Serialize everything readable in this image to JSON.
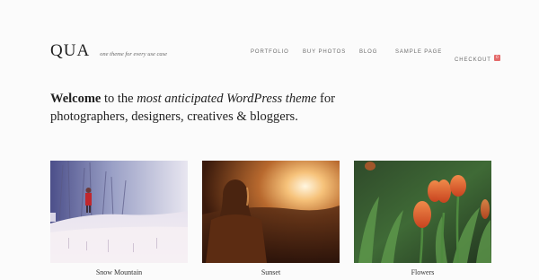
{
  "site": {
    "logo": "QUA",
    "tagline": "one theme for every use case"
  },
  "nav": {
    "items": [
      {
        "label": "PORTFOLIO"
      },
      {
        "label": "BUY PHOTOS"
      },
      {
        "label": "BLOG"
      },
      {
        "label": "SAMPLE PAGE"
      },
      {
        "label": "CHECKOUT"
      }
    ],
    "cart_count": "0"
  },
  "intro": {
    "welcome": "Welcome",
    "to_the": " to the ",
    "emphasis": "most anticipated WordPress theme",
    "for": " for",
    "line2": "photographers, designers, creatives & bloggers."
  },
  "gallery": {
    "items": [
      {
        "caption": "Snow Mountain"
      },
      {
        "caption": "Sunset"
      },
      {
        "caption": "Flowers"
      }
    ]
  }
}
